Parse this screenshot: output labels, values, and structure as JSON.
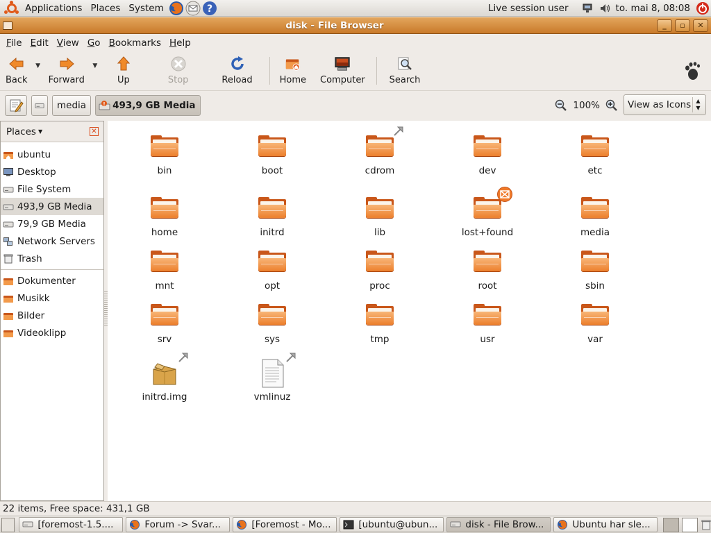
{
  "top_panel": {
    "menus": [
      "Applications",
      "Places",
      "System"
    ],
    "session_user": "Live session user",
    "clock": "to. mai  8, 08:08",
    "launchers": [
      "firefox-icon",
      "mail-icon",
      "help-icon"
    ]
  },
  "window": {
    "title": "disk - File Browser"
  },
  "menubar": {
    "items": [
      {
        "label": "File",
        "mnemonic": "F"
      },
      {
        "label": "Edit",
        "mnemonic": "E"
      },
      {
        "label": "View",
        "mnemonic": "V"
      },
      {
        "label": "Go",
        "mnemonic": "G"
      },
      {
        "label": "Bookmarks",
        "mnemonic": "B"
      },
      {
        "label": "Help",
        "mnemonic": "H"
      }
    ]
  },
  "toolbar": {
    "back": "Back",
    "forward": "Forward",
    "up": "Up",
    "stop": "Stop",
    "reload": "Reload",
    "home": "Home",
    "computer": "Computer",
    "search": "Search"
  },
  "location": {
    "crumbs": [
      "media",
      "493,9 GB Media"
    ],
    "zoom": "100%",
    "view_mode": "View as Icons"
  },
  "sidebar": {
    "header": "Places",
    "items": [
      {
        "label": "ubuntu",
        "icon": "home-folder-icon"
      },
      {
        "label": "Desktop",
        "icon": "desktop-icon"
      },
      {
        "label": "File System",
        "icon": "drive-icon"
      },
      {
        "label": "493,9 GB Media",
        "icon": "drive-icon",
        "selected": true
      },
      {
        "label": "79,9 GB Media",
        "icon": "drive-icon"
      },
      {
        "label": "Network Servers",
        "icon": "network-icon"
      },
      {
        "label": "Trash",
        "icon": "trash-icon"
      }
    ],
    "bookmarks": [
      {
        "label": "Dokumenter",
        "icon": "folder-icon"
      },
      {
        "label": "Musikk",
        "icon": "folder-icon"
      },
      {
        "label": "Bilder",
        "icon": "folder-icon"
      },
      {
        "label": "Videoklipp",
        "icon": "folder-icon"
      }
    ]
  },
  "files": [
    {
      "name": "bin",
      "type": "folder"
    },
    {
      "name": "boot",
      "type": "folder"
    },
    {
      "name": "cdrom",
      "type": "folder",
      "emblem": "link"
    },
    {
      "name": "dev",
      "type": "folder"
    },
    {
      "name": "etc",
      "type": "folder"
    },
    {
      "name": "home",
      "type": "folder"
    },
    {
      "name": "initrd",
      "type": "folder"
    },
    {
      "name": "lib",
      "type": "folder"
    },
    {
      "name": "lost+found",
      "type": "folder",
      "emblem": "unreadable"
    },
    {
      "name": "media",
      "type": "folder"
    },
    {
      "name": "mnt",
      "type": "folder"
    },
    {
      "name": "opt",
      "type": "folder"
    },
    {
      "name": "proc",
      "type": "folder"
    },
    {
      "name": "root",
      "type": "folder"
    },
    {
      "name": "sbin",
      "type": "folder"
    },
    {
      "name": "srv",
      "type": "folder"
    },
    {
      "name": "sys",
      "type": "folder"
    },
    {
      "name": "tmp",
      "type": "folder"
    },
    {
      "name": "usr",
      "type": "folder"
    },
    {
      "name": "var",
      "type": "folder"
    },
    {
      "name": "initrd.img",
      "type": "package",
      "emblem": "link"
    },
    {
      "name": "vmlinuz",
      "type": "file",
      "emblem": "link"
    }
  ],
  "statusbar": {
    "text": "22 items, Free space: 431,1 GB"
  },
  "taskbar": {
    "tasks": [
      {
        "label": "[foremost-1.5....",
        "icon": "drive-icon",
        "active": false
      },
      {
        "label": "Forum -> Svar...",
        "icon": "firefox-icon",
        "active": false
      },
      {
        "label": "[Foremost - Mo...",
        "icon": "firefox-icon",
        "active": false
      },
      {
        "label": "[ubuntu@ubun...",
        "icon": "terminal-icon",
        "active": false
      },
      {
        "label": "disk - File Brow...",
        "icon": "drive-icon",
        "active": true
      },
      {
        "label": "Ubuntu har sle...",
        "icon": "firefox-icon",
        "active": false
      }
    ]
  }
}
